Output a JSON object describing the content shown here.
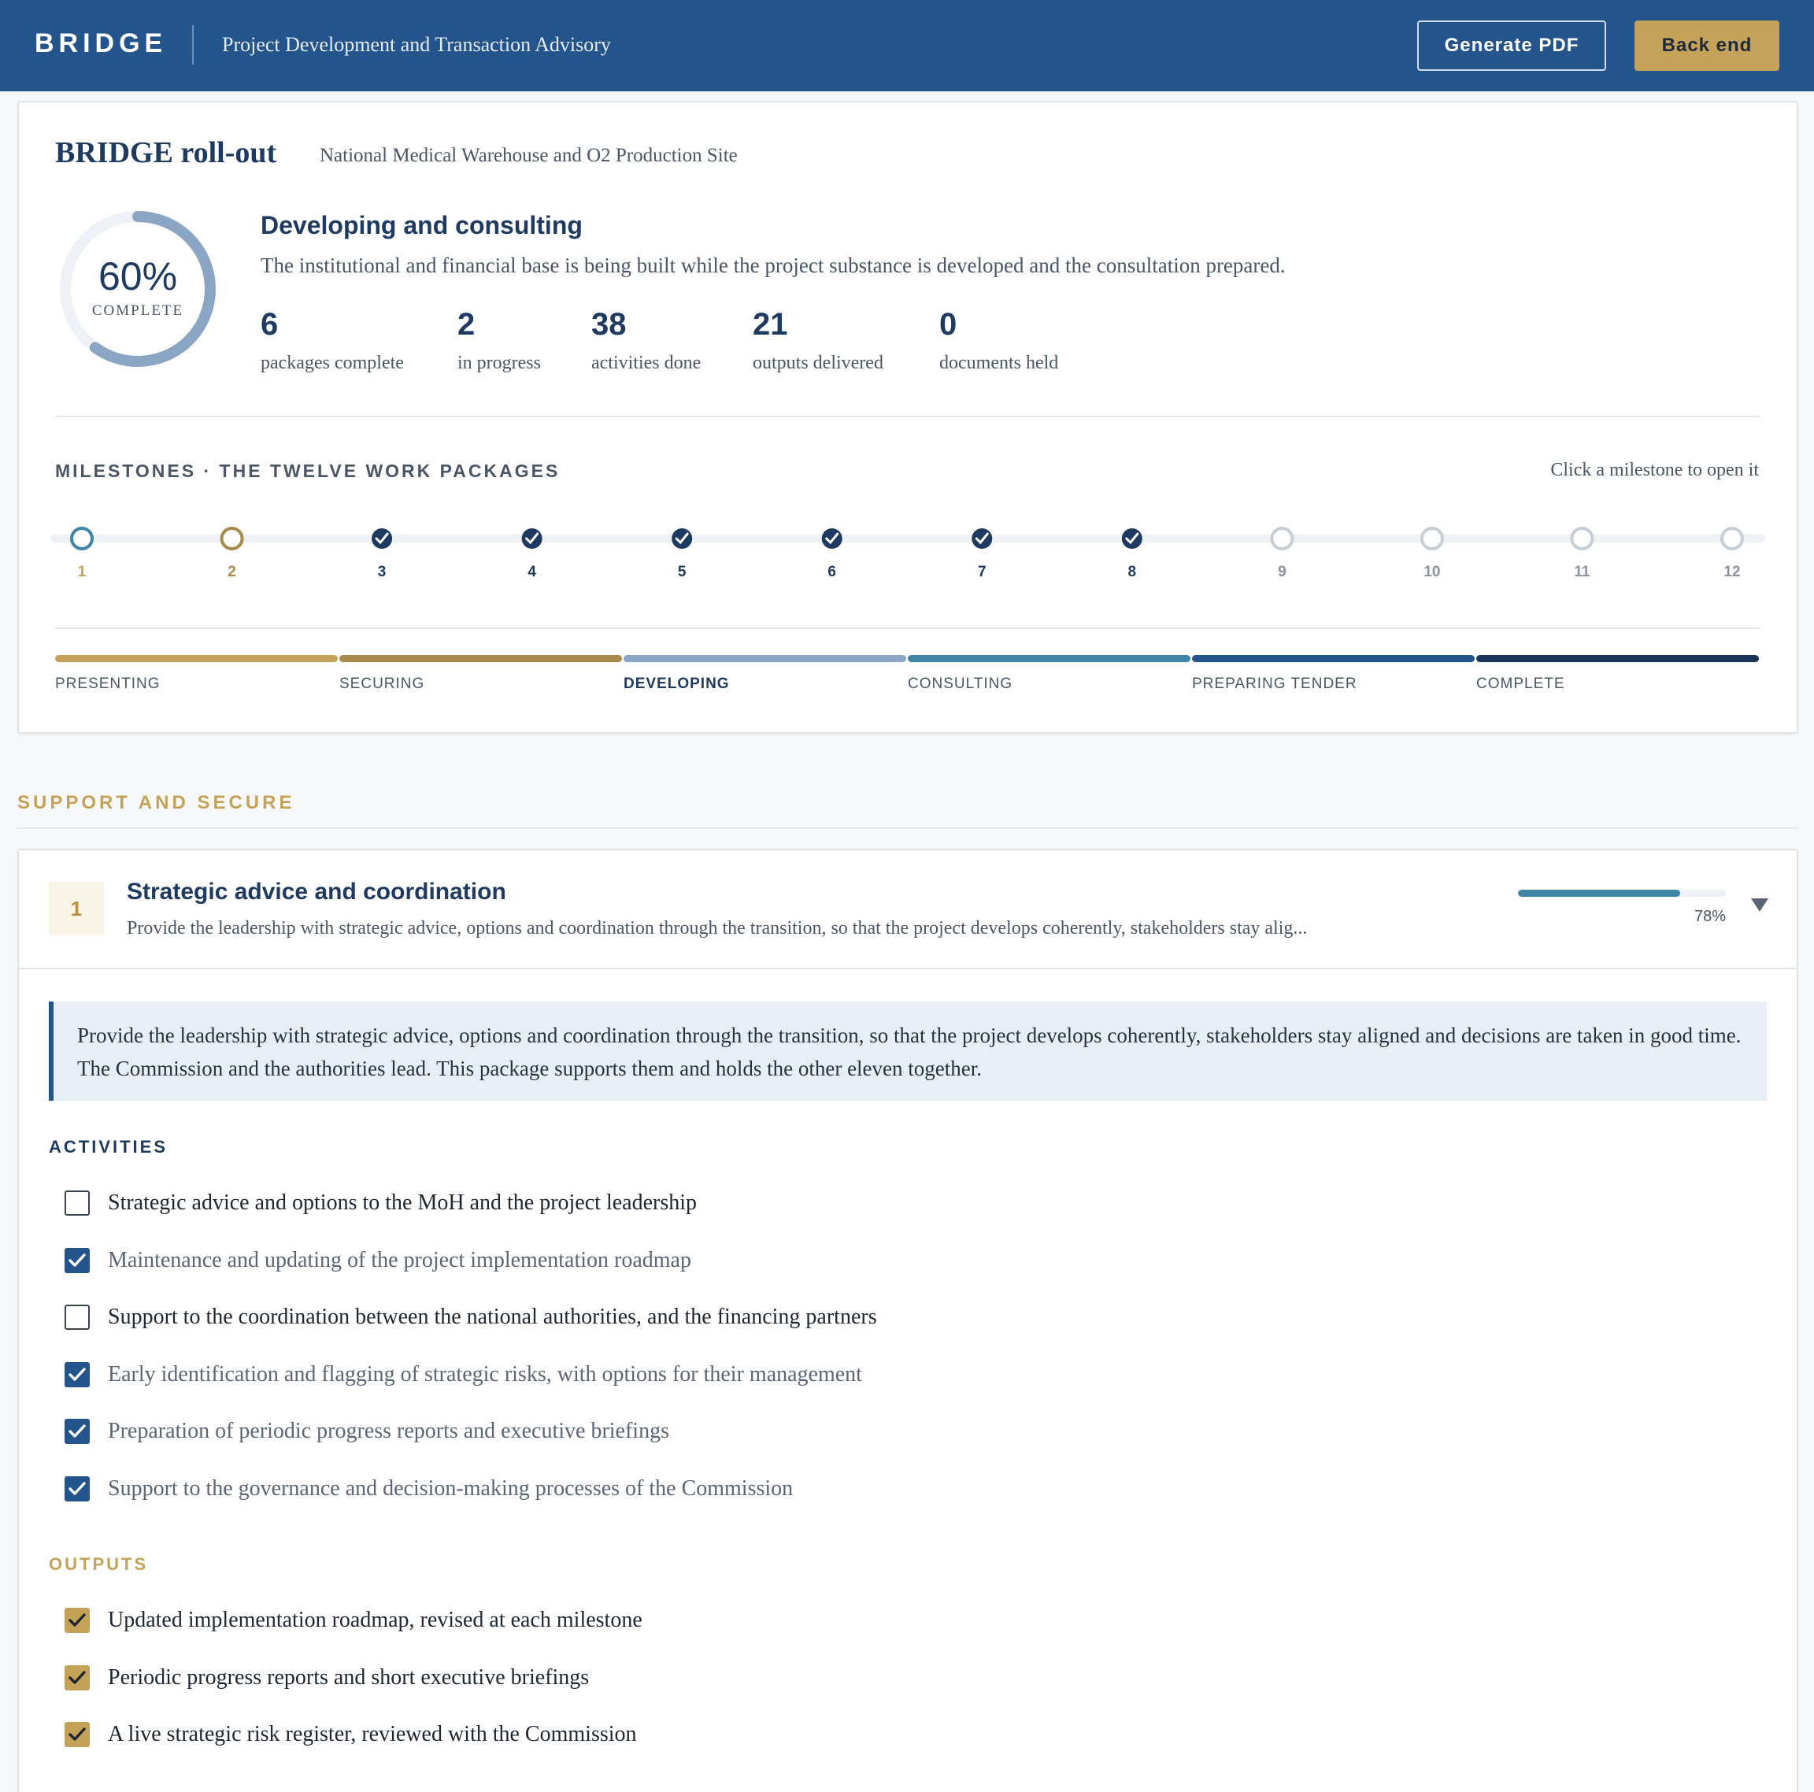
{
  "header": {
    "brand": "BRIDGE",
    "subtitle": "Project Development and Transaction Advisory",
    "generate_pdf_label": "Generate PDF",
    "back_end_label": "Back end"
  },
  "summary": {
    "title": "BRIDGE roll-out",
    "subtitle": "National Medical Warehouse and O2 Production Site",
    "progress_percent": 60,
    "progress_text": "60%",
    "progress_label": "COMPLETE",
    "phase_title": "Developing and consulting",
    "phase_description": "The institutional and financial base is being built while the project substance is developed and the consultation prepared.",
    "stats": [
      {
        "value": "6",
        "label": "packages complete"
      },
      {
        "value": "2",
        "label": "in progress"
      },
      {
        "value": "38",
        "label": "activities done"
      },
      {
        "value": "21",
        "label": "outputs delivered"
      },
      {
        "value": "0",
        "label": "documents held"
      }
    ]
  },
  "milestones": {
    "heading": "MILESTONES · THE TWELVE WORK PACKAGES",
    "hint": "Click a milestone to open it",
    "items": [
      {
        "number": "1",
        "status": "in-progress",
        "color": "#3f85a8"
      },
      {
        "number": "2",
        "status": "in-progress",
        "color": "#a88a4f"
      },
      {
        "number": "3",
        "status": "complete",
        "color": "#1f3a60"
      },
      {
        "number": "4",
        "status": "complete",
        "color": "#1f3a60"
      },
      {
        "number": "5",
        "status": "complete",
        "color": "#1f3a60"
      },
      {
        "number": "6",
        "status": "complete",
        "color": "#1f3a60"
      },
      {
        "number": "7",
        "status": "complete",
        "color": "#1f3a60"
      },
      {
        "number": "8",
        "status": "complete",
        "color": "#1f3a60"
      },
      {
        "number": "9",
        "status": "not-started",
        "color": "#c9ced6"
      },
      {
        "number": "10",
        "status": "not-started",
        "color": "#c9ced6"
      },
      {
        "number": "11",
        "status": "not-started",
        "color": "#c9ced6"
      },
      {
        "number": "12",
        "status": "not-started",
        "color": "#c9ced6"
      }
    ],
    "track_progress_fraction": 0.6
  },
  "phases": [
    {
      "label": "PRESENTING",
      "color": "#c4a257",
      "active": false
    },
    {
      "label": "SECURING",
      "color": "#a88a4f",
      "active": false
    },
    {
      "label": "DEVELOPING",
      "color": "#8aa6c4",
      "active": true
    },
    {
      "label": "CONSULTING",
      "color": "#3f85a8",
      "active": false
    },
    {
      "label": "PREPARING TENDER",
      "color": "#23548c",
      "active": false
    },
    {
      "label": "COMPLETE",
      "color": "#1b3558",
      "active": false
    }
  ],
  "section": {
    "heading": "SUPPORT AND SECURE"
  },
  "package": {
    "number": "1",
    "title": "Strategic advice and coordination",
    "description_truncated": "Provide the leadership with strategic advice, options and coordination through the transition, so that the project develops coherently, stakeholders stay alig...",
    "progress_percent": 78,
    "progress_text": "78%",
    "intro": "Provide the leadership with strategic advice, options and coordination through the transition, so that the project develops coherently, stakeholders stay aligned and decisions are taken in good time. The Commission and the authorities lead. This package supports them and holds the other eleven together.",
    "activities_heading": "ACTIVITIES",
    "activities": [
      {
        "label": "Strategic advice and options to the MoH and the project leadership",
        "checked": false
      },
      {
        "label": "Maintenance and updating of the project implementation roadmap",
        "checked": true
      },
      {
        "label": "Support to the coordination between the national authorities, and the financing partners",
        "checked": false
      },
      {
        "label": "Early identification and flagging of strategic risks, with options for their management",
        "checked": true
      },
      {
        "label": "Preparation of periodic progress reports and executive briefings",
        "checked": true
      },
      {
        "label": "Support to the governance and decision-making processes of the Commission",
        "checked": true
      }
    ],
    "outputs_heading": "OUTPUTS",
    "outputs": [
      {
        "label": "Updated implementation roadmap, revised at each milestone",
        "checked": true
      },
      {
        "label": "Periodic progress reports and short executive briefings",
        "checked": true
      },
      {
        "label": "A live strategic risk register, reviewed with the Commission",
        "checked": true
      }
    ]
  },
  "colors": {
    "header_bg": "#23548c",
    "accent_gold": "#c4a257",
    "primary_navy": "#1f3a60"
  }
}
